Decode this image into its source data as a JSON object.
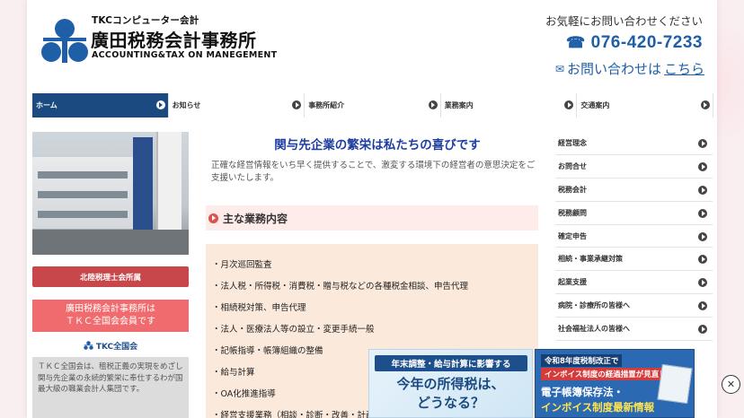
{
  "header": {
    "company_group": "TKCコンピューター会計",
    "company_name": "廣田税務会計事務所",
    "company_english": "ACCOUNTING&TAX ON MANEGEMENT",
    "contact_lead": "お気軽にお問い合わせください",
    "phone": "076-420-7233",
    "inquiry_prefix": "お問い合わせは",
    "inquiry_link": "こちら"
  },
  "nav": [
    {
      "label": "ホーム",
      "active": true
    },
    {
      "label": "お知らせ",
      "active": false
    },
    {
      "label": "事務所紹介",
      "active": false
    },
    {
      "label": "業務案内",
      "active": false
    },
    {
      "label": "交通案内",
      "active": false
    }
  ],
  "left": {
    "red_button": "北陸税理士会所属",
    "member_line1": "廣田税務会計事務所は",
    "member_line2": "ＴＫＣ全国会会員です",
    "tkc_badge": "TKC全国会",
    "tkc_desc": "ＴＫＣ全国会は、租税正義の実現をめざし関与先企業の永続的繁栄に奉仕するわが国最大級の職業会計人集団です。"
  },
  "main": {
    "headline": "関与先企業の繁栄は私たちの喜びです",
    "intro": "正確な経営情報をいち早く提供することで、激変する環境下の経営者の意思決定をご支援いたします。",
    "section_title": "主な業務内容",
    "services": [
      "・月次巡回監査",
      "・法人税・所得税・消費税・贈与税などの各種税金相談、申告代理",
      "・相続税対策、申告代理",
      "・法人・医療法人等の設立・変更手続一般",
      "・記帳指導・帳簿組織の整備",
      "・給与計算",
      "・OA化推進指導",
      "・経営支援業務（相談・診断・改善・計画）"
    ]
  },
  "sidebar": [
    "経営理念",
    "お問合せ",
    "税務会計",
    "税務顧問",
    "確定申告",
    "相続・事業承継対策",
    "起業支援",
    "病院・診療所の皆様へ",
    "社会福祉法人の皆様へ"
  ],
  "banners": {
    "b1_tag": "年末調整・給与計算に影響する",
    "b1_line1": "今年の所得税は、",
    "b1_line2": "どうなる？",
    "b2_line1": "令和8年度税制改正で",
    "b2_line2": "インボイス制度の経過措置が見直し",
    "b2_line3": "電子帳簿保存法・",
    "b2_line4": "インボイス制度最新情報"
  },
  "colors": {
    "nav_active": "#1b4a80",
    "accent_blue": "#1f5fa8",
    "headline_blue": "#1d3ea0",
    "red_button": "#c8474b",
    "pink_box": "#f06b6d",
    "service_bg": "#fbe9db"
  }
}
